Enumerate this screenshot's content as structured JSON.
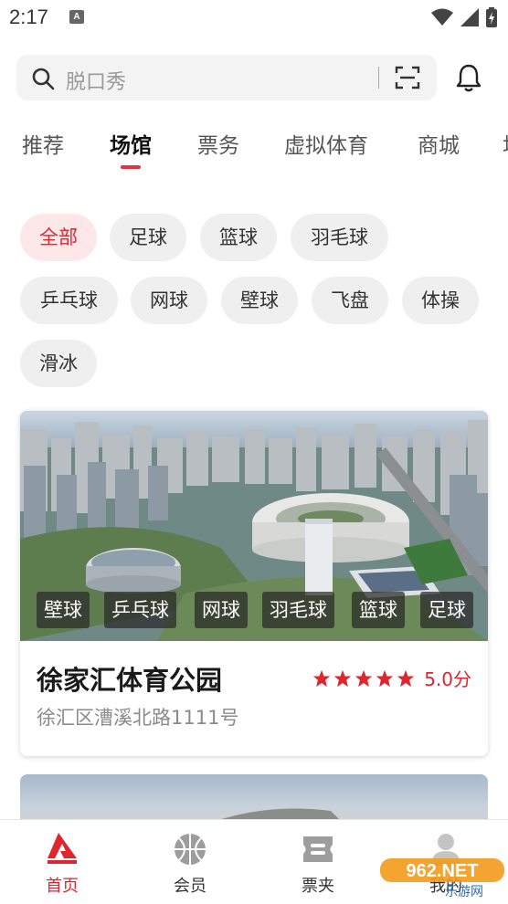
{
  "status_bar": {
    "time": "2:17",
    "notification_icon": "A"
  },
  "search": {
    "placeholder": "脱口秀"
  },
  "tabs": [
    {
      "label": "推荐"
    },
    {
      "label": "场馆"
    },
    {
      "label": "票务"
    },
    {
      "label": "虚拟体育"
    },
    {
      "label": "商城"
    },
    {
      "label": "场"
    }
  ],
  "active_tab": "场馆",
  "categories": [
    "全部",
    "足球",
    "篮球",
    "羽毛球",
    "乒乓球",
    "网球",
    "壁球",
    "飞盘",
    "体操",
    "滑冰"
  ],
  "active_category": "全部",
  "venue": {
    "tags": [
      "壁球",
      "乒乓球",
      "网球",
      "羽毛球",
      "篮球",
      "足球"
    ],
    "name": "徐家汇体育公园",
    "address": "徐汇区漕溪北路1111号",
    "rating": "5.0分",
    "stars": 5
  },
  "bottom_nav": [
    {
      "label": "首页",
      "icon": "home-logo-icon"
    },
    {
      "label": "会员",
      "icon": "basketball-icon"
    },
    {
      "label": "票夹",
      "icon": "ticket-icon"
    },
    {
      "label": "我的",
      "icon": "profile-icon"
    }
  ],
  "watermark": {
    "text": "962.NET",
    "subtext": "乐游网"
  },
  "colors": {
    "accent": "#e1252f",
    "chip_bg": "#efefef",
    "chip_active_bg": "#fde7e9"
  }
}
